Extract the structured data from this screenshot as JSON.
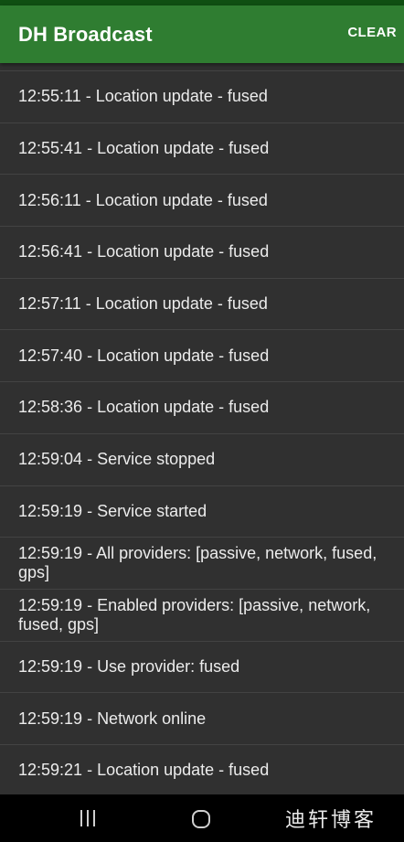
{
  "app_bar": {
    "title": "DH Broadcast",
    "clear_label": "CLEAR",
    "color": "#2f7d31"
  },
  "log": {
    "entries": [
      "12:55:11 - Location update - fused",
      "12:55:41 - Location update - fused",
      "12:56:11 - Location update - fused",
      "12:56:41 - Location update - fused",
      "12:57:11 - Location update - fused",
      "12:57:40 - Location update - fused",
      "12:58:36 - Location update - fused",
      "12:59:04 - Service stopped",
      "12:59:19 - Service started",
      "12:59:19 - All providers: [passive, network, fused, gps]",
      "12:59:19 - Enabled providers: [passive, network, fused, gps]",
      "12:59:19 - Use provider: fused",
      "12:59:19 - Network online",
      "12:59:21 - Location update - fused"
    ]
  },
  "nav_bar": {
    "icons": [
      "recents-icon",
      "home-icon"
    ],
    "watermark": "迪轩博客"
  }
}
